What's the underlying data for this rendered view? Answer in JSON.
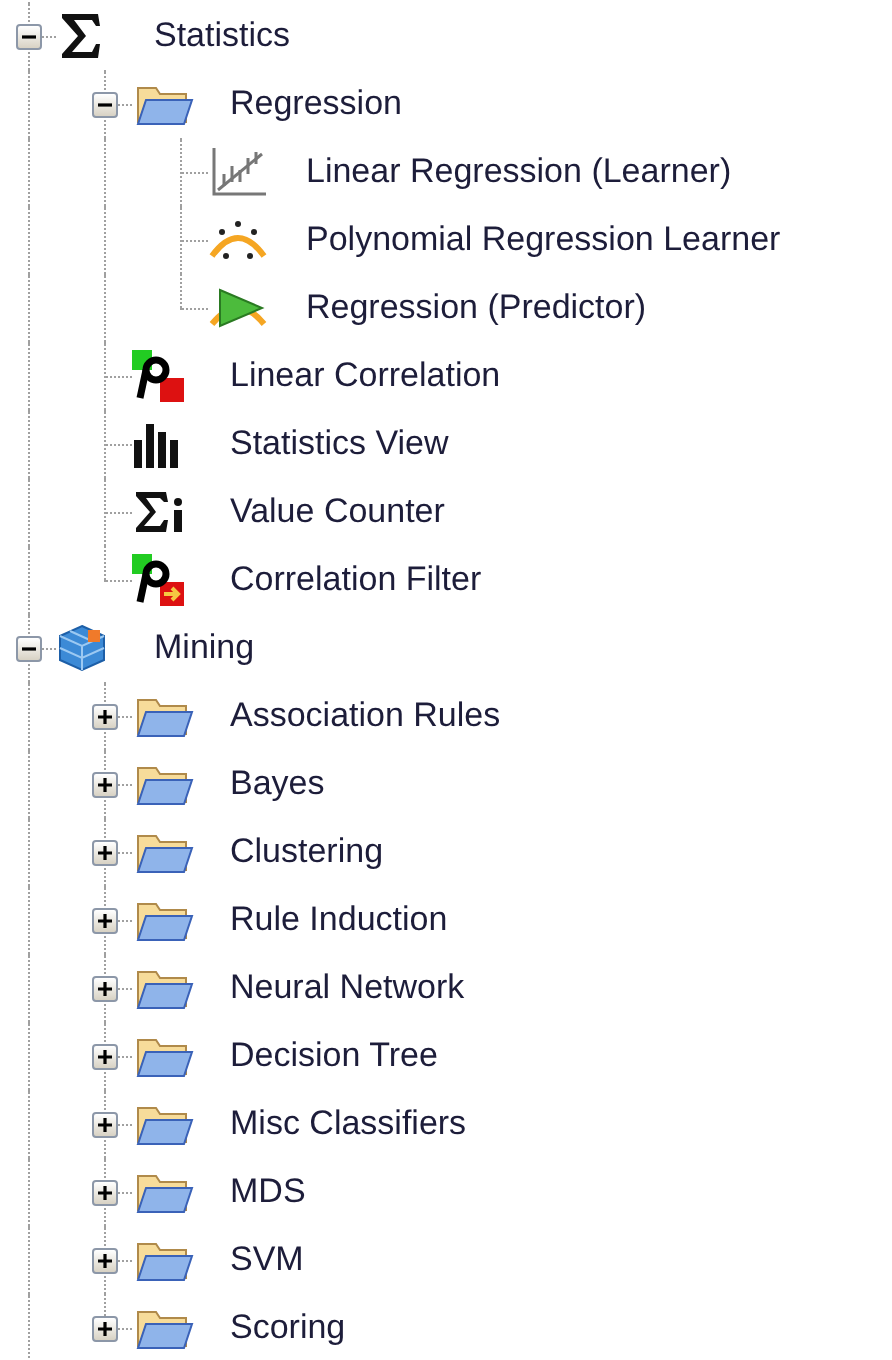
{
  "tree": [
    {
      "label": "Statistics",
      "expanded": true,
      "children": [
        {
          "label": "Regression",
          "expanded": true,
          "children": [
            {
              "label": "Linear Regression (Learner)"
            },
            {
              "label": "Polynomial Regression Learner"
            },
            {
              "label": "Regression (Predictor)"
            }
          ]
        },
        {
          "label": "Linear Correlation"
        },
        {
          "label": "Statistics View"
        },
        {
          "label": "Value Counter"
        },
        {
          "label": "Correlation Filter"
        }
      ]
    },
    {
      "label": "Mining",
      "expanded": true,
      "children": [
        {
          "label": "Association Rules",
          "expanded": false
        },
        {
          "label": "Bayes",
          "expanded": false
        },
        {
          "label": "Clustering",
          "expanded": false
        },
        {
          "label": "Rule Induction",
          "expanded": false
        },
        {
          "label": "Neural Network",
          "expanded": false
        },
        {
          "label": "Decision Tree",
          "expanded": false
        },
        {
          "label": "Misc Classifiers",
          "expanded": false
        },
        {
          "label": "MDS",
          "expanded": false
        },
        {
          "label": "SVM",
          "expanded": false
        },
        {
          "label": "Scoring",
          "expanded": false
        }
      ]
    }
  ]
}
